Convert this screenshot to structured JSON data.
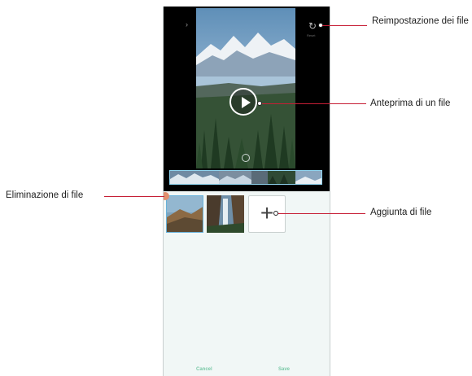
{
  "editor": {
    "top_left_text": "",
    "reset_label": "Reset",
    "cancel_label": "Cancel",
    "save_label": "Save"
  },
  "callouts": {
    "reset": "Reimpostazione dei file",
    "preview": "Anteprima di un file",
    "delete": "Eliminazione di file",
    "add": "Aggiunta di file"
  },
  "icons": {
    "reset": "refresh-icon",
    "play": "play-icon",
    "add": "plus-icon",
    "delete": "delete-dot-icon"
  },
  "colors": {
    "callout_line": "#c61e35",
    "accent_green": "#7cc9a8",
    "selected_border": "#67b1d9",
    "delete_dot": "#e18f6d"
  }
}
